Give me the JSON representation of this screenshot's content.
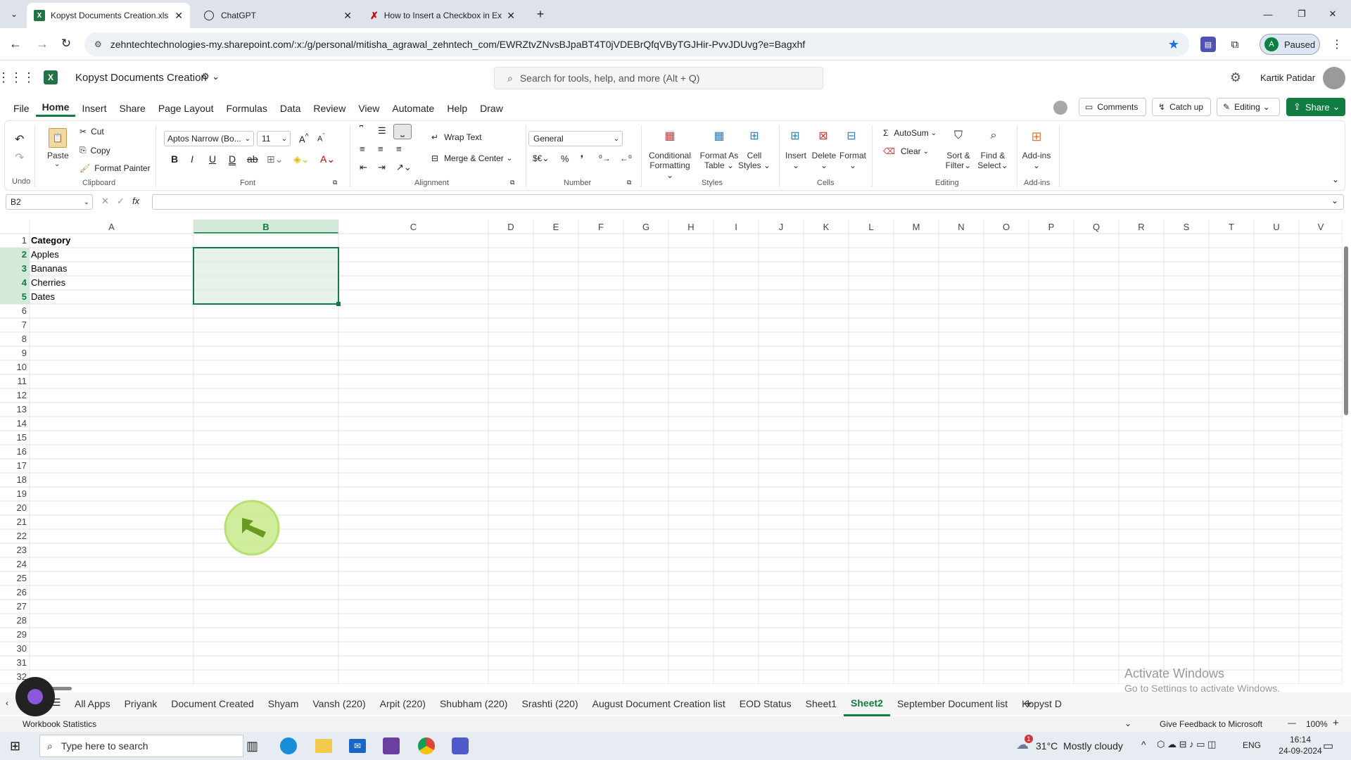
{
  "browser": {
    "tabs": [
      {
        "title": "Kopyst Documents Creation.xls",
        "active": true
      },
      {
        "title": "ChatGPT",
        "active": false
      },
      {
        "title": "How to Insert a Checkbox in Ex",
        "active": false
      }
    ],
    "url": "zehntechtechnologies-my.sharepoint.com/:x:/g/personal/mitisha_agrawal_zehntech_com/EWRZtvZNvsBJpaBT4T0jVDEBrQfqVByTGJHir-PvvJDUvg?e=Bagxhf",
    "profile_label": "Paused",
    "profile_initial": "A"
  },
  "app": {
    "doc_title": "Kopyst Documents Creation",
    "search_placeholder": "Search for tools, help, and more (Alt + Q)",
    "user_name": "Kartik Patidar"
  },
  "menu": [
    "File",
    "Home",
    "Insert",
    "Share",
    "Page Layout",
    "Formulas",
    "Data",
    "Review",
    "View",
    "Automate",
    "Help",
    "Draw"
  ],
  "menu_active": "Home",
  "actions": {
    "comments": "Comments",
    "catch_up": "Catch up",
    "editing": "Editing",
    "share": "Share"
  },
  "ribbon": {
    "undo_label": "Undo",
    "paste": "Paste",
    "cut": "Cut",
    "copy": "Copy",
    "format_painter": "Format Painter",
    "clipboard": "Clipboard",
    "font_name": "Aptos Narrow (Bo...",
    "font_size": "11",
    "font": "Font",
    "wrap_text": "Wrap Text",
    "merge_center": "Merge & Center",
    "alignment": "Alignment",
    "number_format": "General",
    "number": "Number",
    "cond_fmt_1": "Conditional",
    "cond_fmt_2": "Formatting",
    "fmt_table_1": "Format As",
    "fmt_table_2": "Table",
    "cell_styles_1": "Cell",
    "cell_styles_2": "Styles",
    "styles": "Styles",
    "insert": "Insert",
    "delete": "Delete",
    "format": "Format",
    "cells": "Cells",
    "autosum": "AutoSum",
    "clear": "Clear",
    "sort_1": "Sort &",
    "sort_2": "Filter",
    "find_1": "Find &",
    "find_2": "Select",
    "editing": "Editing",
    "addins": "Add-ins",
    "addins_grp": "Add-ins"
  },
  "formula_bar": {
    "name_box": "B2",
    "formula": ""
  },
  "columns": [
    "A",
    "B",
    "C",
    "D",
    "E",
    "F",
    "G",
    "H",
    "I",
    "J",
    "K",
    "L",
    "M",
    "N",
    "O",
    "P",
    "Q",
    "R",
    "S",
    "T",
    "U",
    "V"
  ],
  "rows": [
    "1",
    "2",
    "3",
    "4",
    "5",
    "6",
    "7",
    "8",
    "9",
    "10",
    "11",
    "12",
    "13",
    "14",
    "15",
    "16",
    "17",
    "18",
    "19",
    "20",
    "21",
    "22",
    "23",
    "24",
    "25",
    "26",
    "27",
    "28",
    "29",
    "30",
    "31",
    "32"
  ],
  "cells": {
    "A1": "Category",
    "A2": "Apples",
    "A3": "Bananas",
    "A4": "Cherries",
    "A5": "Dates"
  },
  "sheet_tabs": [
    "All Apps",
    "Priyank",
    "Document Created",
    "Shyam",
    "Vansh (220)",
    "Arpit (220)",
    "Shubham (220)",
    "Srashti (220)",
    "August Document Creation list",
    "EOD Status",
    "Sheet1",
    "Sheet2",
    "September Document list",
    "Kopyst D"
  ],
  "active_sheet": "Sheet2",
  "status": {
    "left": "Workbook Statistics",
    "feedback": "Give Feedback to Microsoft",
    "zoom": "100%"
  },
  "watermark": {
    "line1": "Activate Windows",
    "line2": "Go to Settings to activate Windows."
  },
  "taskbar": {
    "search": "Type here to search",
    "weather": "31°C  Mostly cloudy",
    "lang": "ENG",
    "time": "16:14",
    "date": "24-09-2024",
    "notif_count": "1"
  },
  "colors": {
    "excel_green": "#217346",
    "selection_green": "#107c41",
    "browser_bar": "#dee3eb"
  }
}
